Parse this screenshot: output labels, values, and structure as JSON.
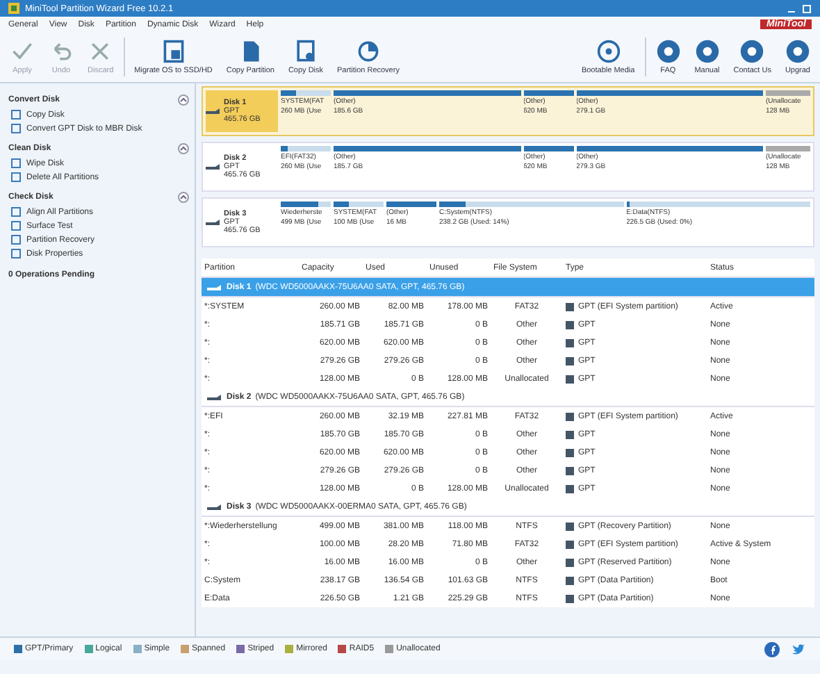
{
  "window": {
    "title": "MiniTool Partition Wizard Free 10.2.1",
    "logo": "MiniTool"
  },
  "menu": [
    "General",
    "View",
    "Disk",
    "Partition",
    "Dynamic Disk",
    "Wizard",
    "Help"
  ],
  "toolbar": [
    {
      "label": "Apply",
      "disabled": true
    },
    {
      "label": "Undo",
      "disabled": true
    },
    {
      "label": "Discard",
      "disabled": true
    },
    {
      "label": "Migrate OS to SSD/HD",
      "disabled": false
    },
    {
      "label": "Copy Partition",
      "disabled": false
    },
    {
      "label": "Copy Disk",
      "disabled": false
    },
    {
      "label": "Partition Recovery",
      "disabled": false
    },
    {
      "label": "Bootable Media",
      "disabled": false
    },
    {
      "label": "FAQ",
      "disabled": false
    },
    {
      "label": "Manual",
      "disabled": false
    },
    {
      "label": "Contact Us",
      "disabled": false
    },
    {
      "label": "Upgrad",
      "disabled": false
    }
  ],
  "sidebar": [
    {
      "title": "Convert Disk",
      "expanded": true,
      "items": [
        "Copy Disk",
        "Convert GPT Disk to MBR Disk"
      ]
    },
    {
      "title": "Clean Disk",
      "expanded": true,
      "items": [
        "Wipe Disk",
        "Delete All Partitions"
      ]
    },
    {
      "title": "Check Disk",
      "expanded": true,
      "items": [
        "Align All Partitions",
        "Surface Test",
        "Partition Recovery",
        "Disk Properties"
      ]
    }
  ],
  "pending": "0 Operations Pending",
  "disk_map": [
    {
      "name": "Disk 1",
      "style": "GPT",
      "size": "465.76 GB",
      "selected": true,
      "partitions": [
        {
          "kind": "small",
          "label": "SYSTEM(FAT",
          "size": "260 MB (Use",
          "level": 0.3
        },
        {
          "kind": "large",
          "label": "(Other)",
          "size": "185.6 GB",
          "level": 1
        },
        {
          "kind": "small",
          "label": "(Other)",
          "size": "620 MB",
          "level": 1
        },
        {
          "kind": "large",
          "label": "(Other)",
          "size": "279.1 GB",
          "level": 1
        },
        {
          "kind": "unallocated",
          "label": "(Unallocate",
          "size": "128 MB",
          "level": 1
        }
      ]
    },
    {
      "name": "Disk 2",
      "style": "GPT",
      "size": "465.76 GB",
      "selected": false,
      "partitions": [
        {
          "kind": "small",
          "label": "EFI(FAT32)",
          "size": "260 MB (Use",
          "level": 0.15
        },
        {
          "kind": "large",
          "label": "(Other)",
          "size": "185.7 GB",
          "level": 1
        },
        {
          "kind": "small",
          "label": "(Other)",
          "size": "620 MB",
          "level": 1
        },
        {
          "kind": "large",
          "label": "(Other)",
          "size": "279.3 GB",
          "level": 1
        },
        {
          "kind": "unallocated",
          "label": "(Unallocate",
          "size": "128 MB",
          "level": 1
        }
      ]
    },
    {
      "name": "Disk 3",
      "style": "GPT",
      "size": "465.76 GB",
      "selected": false,
      "partitions": [
        {
          "kind": "small",
          "label": "Wiederherste",
          "size": "499 MB (Use",
          "level": 0.75
        },
        {
          "kind": "small",
          "label": "SYSTEM(FAT",
          "size": "100 MB (Use",
          "level": 0.3
        },
        {
          "kind": "small",
          "label": "(Other)",
          "size": "16 MB",
          "level": 1
        },
        {
          "kind": "large",
          "label": "C:System(NTFS)",
          "size": "238.2 GB (Used: 14%)",
          "level": 0.14
        },
        {
          "kind": "large",
          "label": "E:Data(NTFS)",
          "size": "226.5 GB (Used: 0%)",
          "level": 0.02
        }
      ]
    }
  ],
  "table": {
    "columns": [
      "Partition",
      "Capacity",
      "Used",
      "Unused",
      "File System",
      "Type",
      "Status"
    ],
    "groups": [
      {
        "title": "Disk 1",
        "detail": "(WDC WD5000AAKX-75U6AA0 SATA, GPT, 465.76 GB)",
        "selected": true,
        "rows": [
          [
            "*:SYSTEM",
            "260.00 MB",
            "82.00 MB",
            "178.00 MB",
            "FAT32",
            "GPT (EFI System partition)",
            "Active"
          ],
          [
            "*:",
            "185.71 GB",
            "185.71 GB",
            "0 B",
            "Other",
            "GPT",
            "None"
          ],
          [
            "*:",
            "620.00 MB",
            "620.00 MB",
            "0 B",
            "Other",
            "GPT",
            "None"
          ],
          [
            "*:",
            "279.26 GB",
            "279.26 GB",
            "0 B",
            "Other",
            "GPT",
            "None"
          ],
          [
            "*:",
            "128.00 MB",
            "0 B",
            "128.00 MB",
            "Unallocated",
            "GPT",
            "None"
          ]
        ]
      },
      {
        "title": "Disk 2",
        "detail": "(WDC WD5000AAKX-75U6AA0 SATA, GPT, 465.76 GB)",
        "selected": false,
        "rows": [
          [
            "*:EFI",
            "260.00 MB",
            "32.19 MB",
            "227.81 MB",
            "FAT32",
            "GPT (EFI System partition)",
            "Active"
          ],
          [
            "*:",
            "185.70 GB",
            "185.70 GB",
            "0 B",
            "Other",
            "GPT",
            "None"
          ],
          [
            "*:",
            "620.00 MB",
            "620.00 MB",
            "0 B",
            "Other",
            "GPT",
            "None"
          ],
          [
            "*:",
            "279.26 GB",
            "279.26 GB",
            "0 B",
            "Other",
            "GPT",
            "None"
          ],
          [
            "*:",
            "128.00 MB",
            "0 B",
            "128.00 MB",
            "Unallocated",
            "GPT",
            "None"
          ]
        ]
      },
      {
        "title": "Disk 3",
        "detail": "(WDC WD5000AAKX-00ERMA0 SATA, GPT, 465.76 GB)",
        "selected": false,
        "rows": [
          [
            "*:Wiederherstellung",
            "499.00 MB",
            "381.00 MB",
            "118.00 MB",
            "NTFS",
            "GPT (Recovery Partition)",
            "None"
          ],
          [
            "*:",
            "100.00 MB",
            "28.20 MB",
            "71.80 MB",
            "FAT32",
            "GPT (EFI System partition)",
            "Active & System"
          ],
          [
            "*:",
            "16.00 MB",
            "16.00 MB",
            "0 B",
            "Other",
            "GPT (Reserved Partition)",
            "None"
          ],
          [
            "C:System",
            "238.17 GB",
            "136.54 GB",
            "101.63 GB",
            "NTFS",
            "GPT (Data Partition)",
            "Boot"
          ],
          [
            "E:Data",
            "226.50 GB",
            "1.21 GB",
            "225.29 GB",
            "NTFS",
            "GPT (Data Partition)",
            "None"
          ]
        ]
      }
    ]
  },
  "legend": [
    {
      "label": "GPT/Primary",
      "color": "#2f6fa8"
    },
    {
      "label": "Logical",
      "color": "#4aa89a"
    },
    {
      "label": "Simple",
      "color": "#8ab0c8"
    },
    {
      "label": "Spanned",
      "color": "#c8a070"
    },
    {
      "label": "Striped",
      "color": "#7a6aa8"
    },
    {
      "label": "Mirrored",
      "color": "#a8b040"
    },
    {
      "label": "RAID5",
      "color": "#b84848"
    },
    {
      "label": "Unallocated",
      "color": "#9a9a9a"
    }
  ]
}
